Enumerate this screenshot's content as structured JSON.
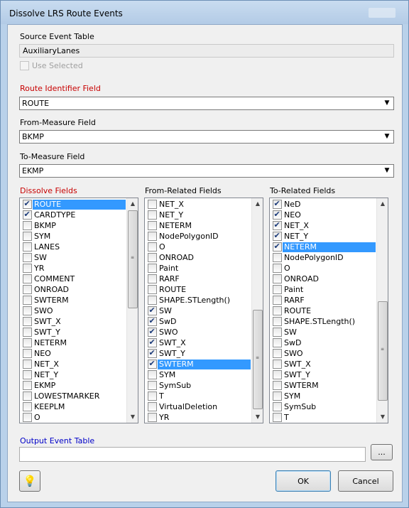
{
  "window": {
    "title": "Dissolve LRS Route Events"
  },
  "source": {
    "label": "Source Event Table",
    "value": "AuxiliaryLanes",
    "use_selected_label": "Use Selected"
  },
  "route_id": {
    "label": "Route Identifier Field",
    "value": "ROUTE"
  },
  "from_measure": {
    "label": "From-Measure Field",
    "value": "BKMP"
  },
  "to_measure": {
    "label": "To-Measure Field",
    "value": "EKMP"
  },
  "dissolve_fields": {
    "label": "Dissolve Fields",
    "items": [
      {
        "label": "ROUTE",
        "checked": true,
        "selected": true
      },
      {
        "label": "CARDTYPE",
        "checked": true,
        "selected": false
      },
      {
        "label": "BKMP",
        "checked": false,
        "selected": false
      },
      {
        "label": "SYM",
        "checked": false,
        "selected": false
      },
      {
        "label": "LANES",
        "checked": false,
        "selected": false
      },
      {
        "label": "SW",
        "checked": false,
        "selected": false
      },
      {
        "label": "YR",
        "checked": false,
        "selected": false
      },
      {
        "label": "COMMENT",
        "checked": false,
        "selected": false
      },
      {
        "label": "ONROAD",
        "checked": false,
        "selected": false
      },
      {
        "label": "SWTERM",
        "checked": false,
        "selected": false
      },
      {
        "label": "SWO",
        "checked": false,
        "selected": false
      },
      {
        "label": "SWT_X",
        "checked": false,
        "selected": false
      },
      {
        "label": "SWT_Y",
        "checked": false,
        "selected": false
      },
      {
        "label": "NETERM",
        "checked": false,
        "selected": false
      },
      {
        "label": "NEO",
        "checked": false,
        "selected": false
      },
      {
        "label": "NET_X",
        "checked": false,
        "selected": false
      },
      {
        "label": "NET_Y",
        "checked": false,
        "selected": false
      },
      {
        "label": "EKMP",
        "checked": false,
        "selected": false
      },
      {
        "label": "LOWESTMARKER",
        "checked": false,
        "selected": false
      },
      {
        "label": "KEEPLM",
        "checked": false,
        "selected": false
      },
      {
        "label": "O",
        "checked": false,
        "selected": false
      }
    ]
  },
  "from_related": {
    "label": "From-Related Fields",
    "items": [
      {
        "label": "NET_X",
        "checked": false,
        "selected": false
      },
      {
        "label": "NET_Y",
        "checked": false,
        "selected": false
      },
      {
        "label": "NETERM",
        "checked": false,
        "selected": false
      },
      {
        "label": "NodePolygonID",
        "checked": false,
        "selected": false
      },
      {
        "label": "O",
        "checked": false,
        "selected": false
      },
      {
        "label": "ONROAD",
        "checked": false,
        "selected": false
      },
      {
        "label": "Paint",
        "checked": false,
        "selected": false
      },
      {
        "label": "RARF",
        "checked": false,
        "selected": false
      },
      {
        "label": "ROUTE",
        "checked": false,
        "selected": false
      },
      {
        "label": "SHAPE.STLength()",
        "checked": false,
        "selected": false
      },
      {
        "label": "SW",
        "checked": true,
        "selected": false
      },
      {
        "label": "SwD",
        "checked": true,
        "selected": false
      },
      {
        "label": "SWO",
        "checked": true,
        "selected": false
      },
      {
        "label": "SWT_X",
        "checked": true,
        "selected": false
      },
      {
        "label": "SWT_Y",
        "checked": true,
        "selected": false
      },
      {
        "label": "SWTERM",
        "checked": true,
        "selected": true
      },
      {
        "label": "SYM",
        "checked": false,
        "selected": false
      },
      {
        "label": "SymSub",
        "checked": false,
        "selected": false
      },
      {
        "label": "T",
        "checked": false,
        "selected": false
      },
      {
        "label": "VirtualDeletion",
        "checked": false,
        "selected": false
      },
      {
        "label": "YR",
        "checked": false,
        "selected": false
      }
    ]
  },
  "to_related": {
    "label": "To-Related Fields",
    "items": [
      {
        "label": "NeD",
        "checked": true,
        "selected": false
      },
      {
        "label": "NEO",
        "checked": true,
        "selected": false
      },
      {
        "label": "NET_X",
        "checked": true,
        "selected": false
      },
      {
        "label": "NET_Y",
        "checked": true,
        "selected": false
      },
      {
        "label": "NETERM",
        "checked": true,
        "selected": true
      },
      {
        "label": "NodePolygonID",
        "checked": false,
        "selected": false
      },
      {
        "label": "O",
        "checked": false,
        "selected": false
      },
      {
        "label": "ONROAD",
        "checked": false,
        "selected": false
      },
      {
        "label": "Paint",
        "checked": false,
        "selected": false
      },
      {
        "label": "RARF",
        "checked": false,
        "selected": false
      },
      {
        "label": "ROUTE",
        "checked": false,
        "selected": false
      },
      {
        "label": "SHAPE.STLength()",
        "checked": false,
        "selected": false
      },
      {
        "label": "SW",
        "checked": false,
        "selected": false
      },
      {
        "label": "SwD",
        "checked": false,
        "selected": false
      },
      {
        "label": "SWO",
        "checked": false,
        "selected": false
      },
      {
        "label": "SWT_X",
        "checked": false,
        "selected": false
      },
      {
        "label": "SWT_Y",
        "checked": false,
        "selected": false
      },
      {
        "label": "SWTERM",
        "checked": false,
        "selected": false
      },
      {
        "label": "SYM",
        "checked": false,
        "selected": false
      },
      {
        "label": "SymSub",
        "checked": false,
        "selected": false
      },
      {
        "label": "T",
        "checked": false,
        "selected": false
      }
    ]
  },
  "output": {
    "label": "Output Event Table",
    "value": "",
    "browse_label": "..."
  },
  "buttons": {
    "ok": "OK",
    "cancel": "Cancel",
    "help_icon": "help-lightbulb-icon"
  },
  "colors": {
    "selection": "#3399ff",
    "required_label": "#c80000",
    "output_label": "#0000c8"
  }
}
